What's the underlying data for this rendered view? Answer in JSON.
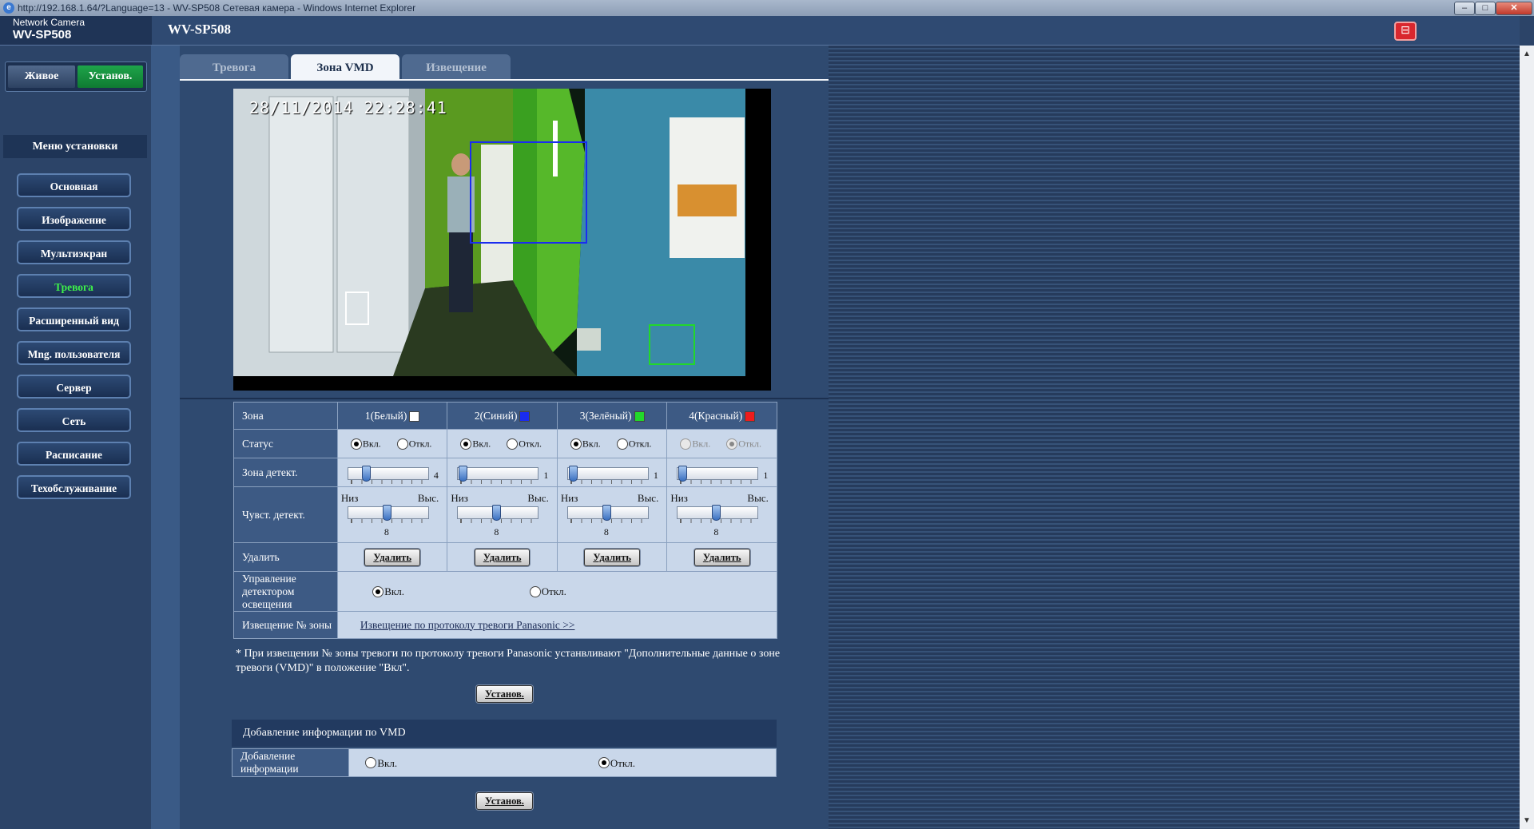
{
  "window": {
    "title": "http://192.168.1.64/?Language=13 - WV-SP508 Сетевая камера - Windows Internet Explorer"
  },
  "brand": {
    "line1": "Network Camera",
    "line2": "WV-SP508"
  },
  "header": {
    "model": "WV-SP508"
  },
  "mode": {
    "live": "Живое",
    "setup": "Установ."
  },
  "sidebar": {
    "header": "Меню установки",
    "items": [
      {
        "label": "Основная"
      },
      {
        "label": "Изображение"
      },
      {
        "label": "Мультиэкран"
      },
      {
        "label": "Тревога",
        "active": true
      },
      {
        "label": "Расширенный вид"
      },
      {
        "label": "Mng. пользователя"
      },
      {
        "label": "Сервер"
      },
      {
        "label": "Сеть"
      },
      {
        "label": "Расписание"
      },
      {
        "label": "Техобслуживание"
      }
    ]
  },
  "tabs": [
    {
      "label": "Тревога",
      "active": false
    },
    {
      "label": "Зона VMD",
      "active": true
    },
    {
      "label": "Извещение",
      "active": false
    }
  ],
  "video": {
    "timestamp": "28/11/2014   22:28:41"
  },
  "zones_table": {
    "row_labels": {
      "zone": "Зона",
      "status": "Статус",
      "detect_area": "Зона детект.",
      "sensitivity": "Чувст. детект.",
      "delete": "Удалить",
      "light_control": "Управление детектором освещения",
      "notification": "Извещение № зоны"
    },
    "on_label": "Вкл.",
    "off_label": "Откл.",
    "low_label": "Низ",
    "high_label": "Выс.",
    "delete_button": "Удалить",
    "zones": [
      {
        "name": "1(Белый)",
        "color": "#ffffff",
        "status": "on",
        "enabled": true,
        "area": "4",
        "sensitivity": "8"
      },
      {
        "name": "2(Синий)",
        "color": "#1a2cf0",
        "status": "on",
        "enabled": true,
        "area": "1",
        "sensitivity": "8"
      },
      {
        "name": "3(Зелёный)",
        "color": "#22d82a",
        "status": "on",
        "enabled": true,
        "area": "1",
        "sensitivity": "8"
      },
      {
        "name": "4(Красный)",
        "color": "#ee1c1c",
        "status": "off",
        "enabled": false,
        "area": "1",
        "sensitivity": "8"
      }
    ],
    "light_on": "Вкл.",
    "light_off": "Откл.",
    "light_value": "on",
    "notify_link": "Извещение по протоколу тревоги Panasonic >>"
  },
  "note": "* При извещении № зоны тревоги по протоколу тревоги Panasonic устанвливают \"Дополнительные данные о зоне тревоги (VMD)\" в положение \"Вкл\".",
  "set_button": "Установ.",
  "vmd_info": {
    "title": "Добавление информации по VMD",
    "row_label": "Добавление информации",
    "on": "Вкл.",
    "off": "Откл.",
    "value": "off"
  },
  "colors": {
    "accent_green": "#3df04a",
    "tab_active_bg": "#f2f5fa",
    "panel_blue": "#3d5a84"
  }
}
